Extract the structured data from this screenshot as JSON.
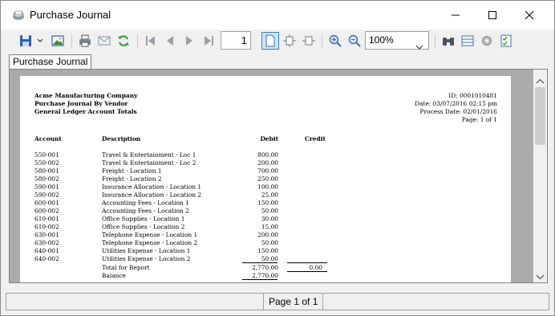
{
  "window": {
    "title": "Purchase Journal",
    "tab": "Purchase Journal"
  },
  "toolbar": {
    "page_number": "1",
    "zoom": "100%"
  },
  "report": {
    "company": "Acme Manufacturing Company",
    "subtitle": "Purchase Journal By Vendor",
    "subtitle2": "General Ledger Account Totals",
    "id": "ID: 0001010481",
    "date": "Date: 03/07/2016 02:15 pm",
    "process_date": "Process Date: 02/01/2016",
    "page": "Page: 1 of 1",
    "columns": {
      "account": "Account",
      "description": "Description",
      "debit": "Debit",
      "credit": "Credit"
    },
    "rows": [
      {
        "account": "550-001",
        "description": "Travel & Entertainment - Loc 1",
        "debit": "800.00"
      },
      {
        "account": "550-002",
        "description": "Travel & Entertainment - Loc 2",
        "debit": "200.00"
      },
      {
        "account": "580-001",
        "description": "Freight - Location 1",
        "debit": "700.00"
      },
      {
        "account": "580-002",
        "description": "Freight - Location 2",
        "debit": "250.00"
      },
      {
        "account": "590-001",
        "description": "Insurance Allocation - Location 1",
        "debit": "100.00"
      },
      {
        "account": "590-002",
        "description": "Insurance Allocation - Location 2",
        "debit": "25.00"
      },
      {
        "account": "600-001",
        "description": "Accounting Fees - Location 1",
        "debit": "150.00"
      },
      {
        "account": "600-002",
        "description": "Accounting Fees - Location 2",
        "debit": "50.00"
      },
      {
        "account": "610-001",
        "description": "Office Supplies - Location 1",
        "debit": "30.00"
      },
      {
        "account": "610-002",
        "description": "Office Supplies - Location 2",
        "debit": "15.00"
      },
      {
        "account": "630-001",
        "description": "Telephone Expense - Location 1",
        "debit": "200.00"
      },
      {
        "account": "630-002",
        "description": "Telephone Expense - Location 2",
        "debit": "50.00"
      },
      {
        "account": "640-001",
        "description": "Utilities Expense - Location 1",
        "debit": "150.00"
      },
      {
        "account": "640-002",
        "description": "Utilities Expense - Location 2",
        "debit": "50.00"
      }
    ],
    "total_label": "Total for Report",
    "total_debit": "2,770.00",
    "total_credit": "0.00",
    "balance_label": "Balance",
    "balance_value": "2,770.00"
  },
  "status": {
    "page": "Page 1 of 1"
  }
}
